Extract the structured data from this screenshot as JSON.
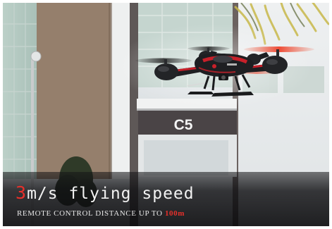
{
  "building_sign": "C5",
  "caption": {
    "speed_value": "3",
    "speed_rest": "m/s flying speed",
    "distance_prefix": "REMOTE CONTROL DISTANCE UP TO ",
    "distance_value": "100m"
  },
  "colors": {
    "accent": "#e8302a",
    "caption_text": "#f2f2f2",
    "drone_body": "#1e1f22",
    "drone_trim": "#c8202a"
  }
}
